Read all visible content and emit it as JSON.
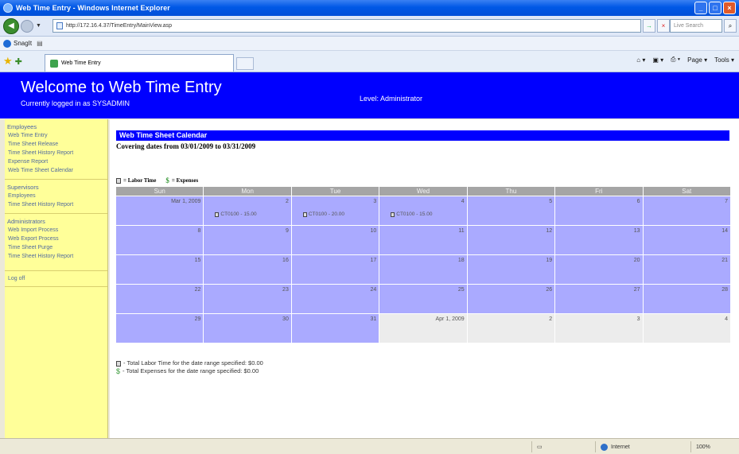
{
  "window": {
    "title": "Web Time Entry - Windows Internet Explorer",
    "minimize": "_",
    "maximize": "□",
    "close": "×"
  },
  "nav": {
    "address": "http://172.16.4.37/TimeEntry/MainView.asp",
    "search_placeholder": "Live Search",
    "go_glyph": "→",
    "stop_glyph": "×"
  },
  "links": {
    "snagit": "SnagIt",
    "extra": "▤"
  },
  "tabs": [
    {
      "label": "Web Time Entry"
    }
  ],
  "command_bar": {
    "home": "⌂ ▾",
    "feeds": "▣ ▾",
    "print": "⎙ ▾",
    "page": "Page ▾",
    "tools": "Tools ▾"
  },
  "header": {
    "welcome": "Welcome to Web Time Entry",
    "logged_in": "Currently logged in as SYSADMIN",
    "level": "Level: Administrator"
  },
  "sidebar": {
    "sections": [
      {
        "heading": "Employees",
        "links": [
          "Web Time Entry",
          "Time Sheet Release",
          "Time Sheet History Report",
          "Expense Report",
          "Web Time Sheet Calendar"
        ]
      },
      {
        "heading": "Supervisors",
        "links": [
          "Employees",
          "Time Sheet History Report"
        ]
      },
      {
        "heading": "Administrators",
        "links": [
          "Web Import Process",
          "Web Export Process",
          "Time Sheet Purge",
          "Time Sheet History Report"
        ]
      }
    ],
    "logoff": "Log off"
  },
  "calendar": {
    "title": "Web Time Sheet Calendar",
    "covering": "Covering dates from 03/01/2009 to 03/31/2009",
    "legend_labor": "= Labor Time",
    "legend_expenses": "= Expenses",
    "days": [
      "Sun",
      "Mon",
      "Tue",
      "Wed",
      "Thu",
      "Fri",
      "Sat"
    ],
    "weeks": [
      [
        {
          "label": "Mar 1, 2009",
          "in_range": true
        },
        {
          "label": "2",
          "in_range": true,
          "entry": "CT0100 - 15.00"
        },
        {
          "label": "3",
          "in_range": true,
          "entry": "CT0100 - 20.00"
        },
        {
          "label": "4",
          "in_range": true,
          "entry": "CT0100 - 15.00"
        },
        {
          "label": "5",
          "in_range": true
        },
        {
          "label": "6",
          "in_range": true
        },
        {
          "label": "7",
          "in_range": true
        }
      ],
      [
        {
          "label": "8",
          "in_range": true
        },
        {
          "label": "9",
          "in_range": true
        },
        {
          "label": "10",
          "in_range": true
        },
        {
          "label": "11",
          "in_range": true
        },
        {
          "label": "12",
          "in_range": true
        },
        {
          "label": "13",
          "in_range": true
        },
        {
          "label": "14",
          "in_range": true
        }
      ],
      [
        {
          "label": "15",
          "in_range": true
        },
        {
          "label": "16",
          "in_range": true
        },
        {
          "label": "17",
          "in_range": true
        },
        {
          "label": "18",
          "in_range": true
        },
        {
          "label": "19",
          "in_range": true
        },
        {
          "label": "20",
          "in_range": true
        },
        {
          "label": "21",
          "in_range": true
        }
      ],
      [
        {
          "label": "22",
          "in_range": true
        },
        {
          "label": "23",
          "in_range": true
        },
        {
          "label": "24",
          "in_range": true
        },
        {
          "label": "25",
          "in_range": true
        },
        {
          "label": "26",
          "in_range": true
        },
        {
          "label": "27",
          "in_range": true
        },
        {
          "label": "28",
          "in_range": true
        }
      ],
      [
        {
          "label": "29",
          "in_range": true
        },
        {
          "label": "30",
          "in_range": true
        },
        {
          "label": "31",
          "in_range": true
        },
        {
          "label": "Apr 1, 2009",
          "in_range": false
        },
        {
          "label": "2",
          "in_range": false
        },
        {
          "label": "3",
          "in_range": false
        },
        {
          "label": "4",
          "in_range": false
        }
      ]
    ],
    "total_labor": "- Total Labor Time for the date range specified: $0.00",
    "total_expenses": "- Total Expenses for the date range specified: $0.00"
  },
  "colors": {
    "header_bg": "#0000ff",
    "sidebar_bg": "#ffff99",
    "in_range_cell": "#aaaaff",
    "out_range_cell": "#ececec",
    "day_header": "#a5a5a5"
  },
  "status": {
    "zone": "Internet",
    "zoom": "100%"
  }
}
